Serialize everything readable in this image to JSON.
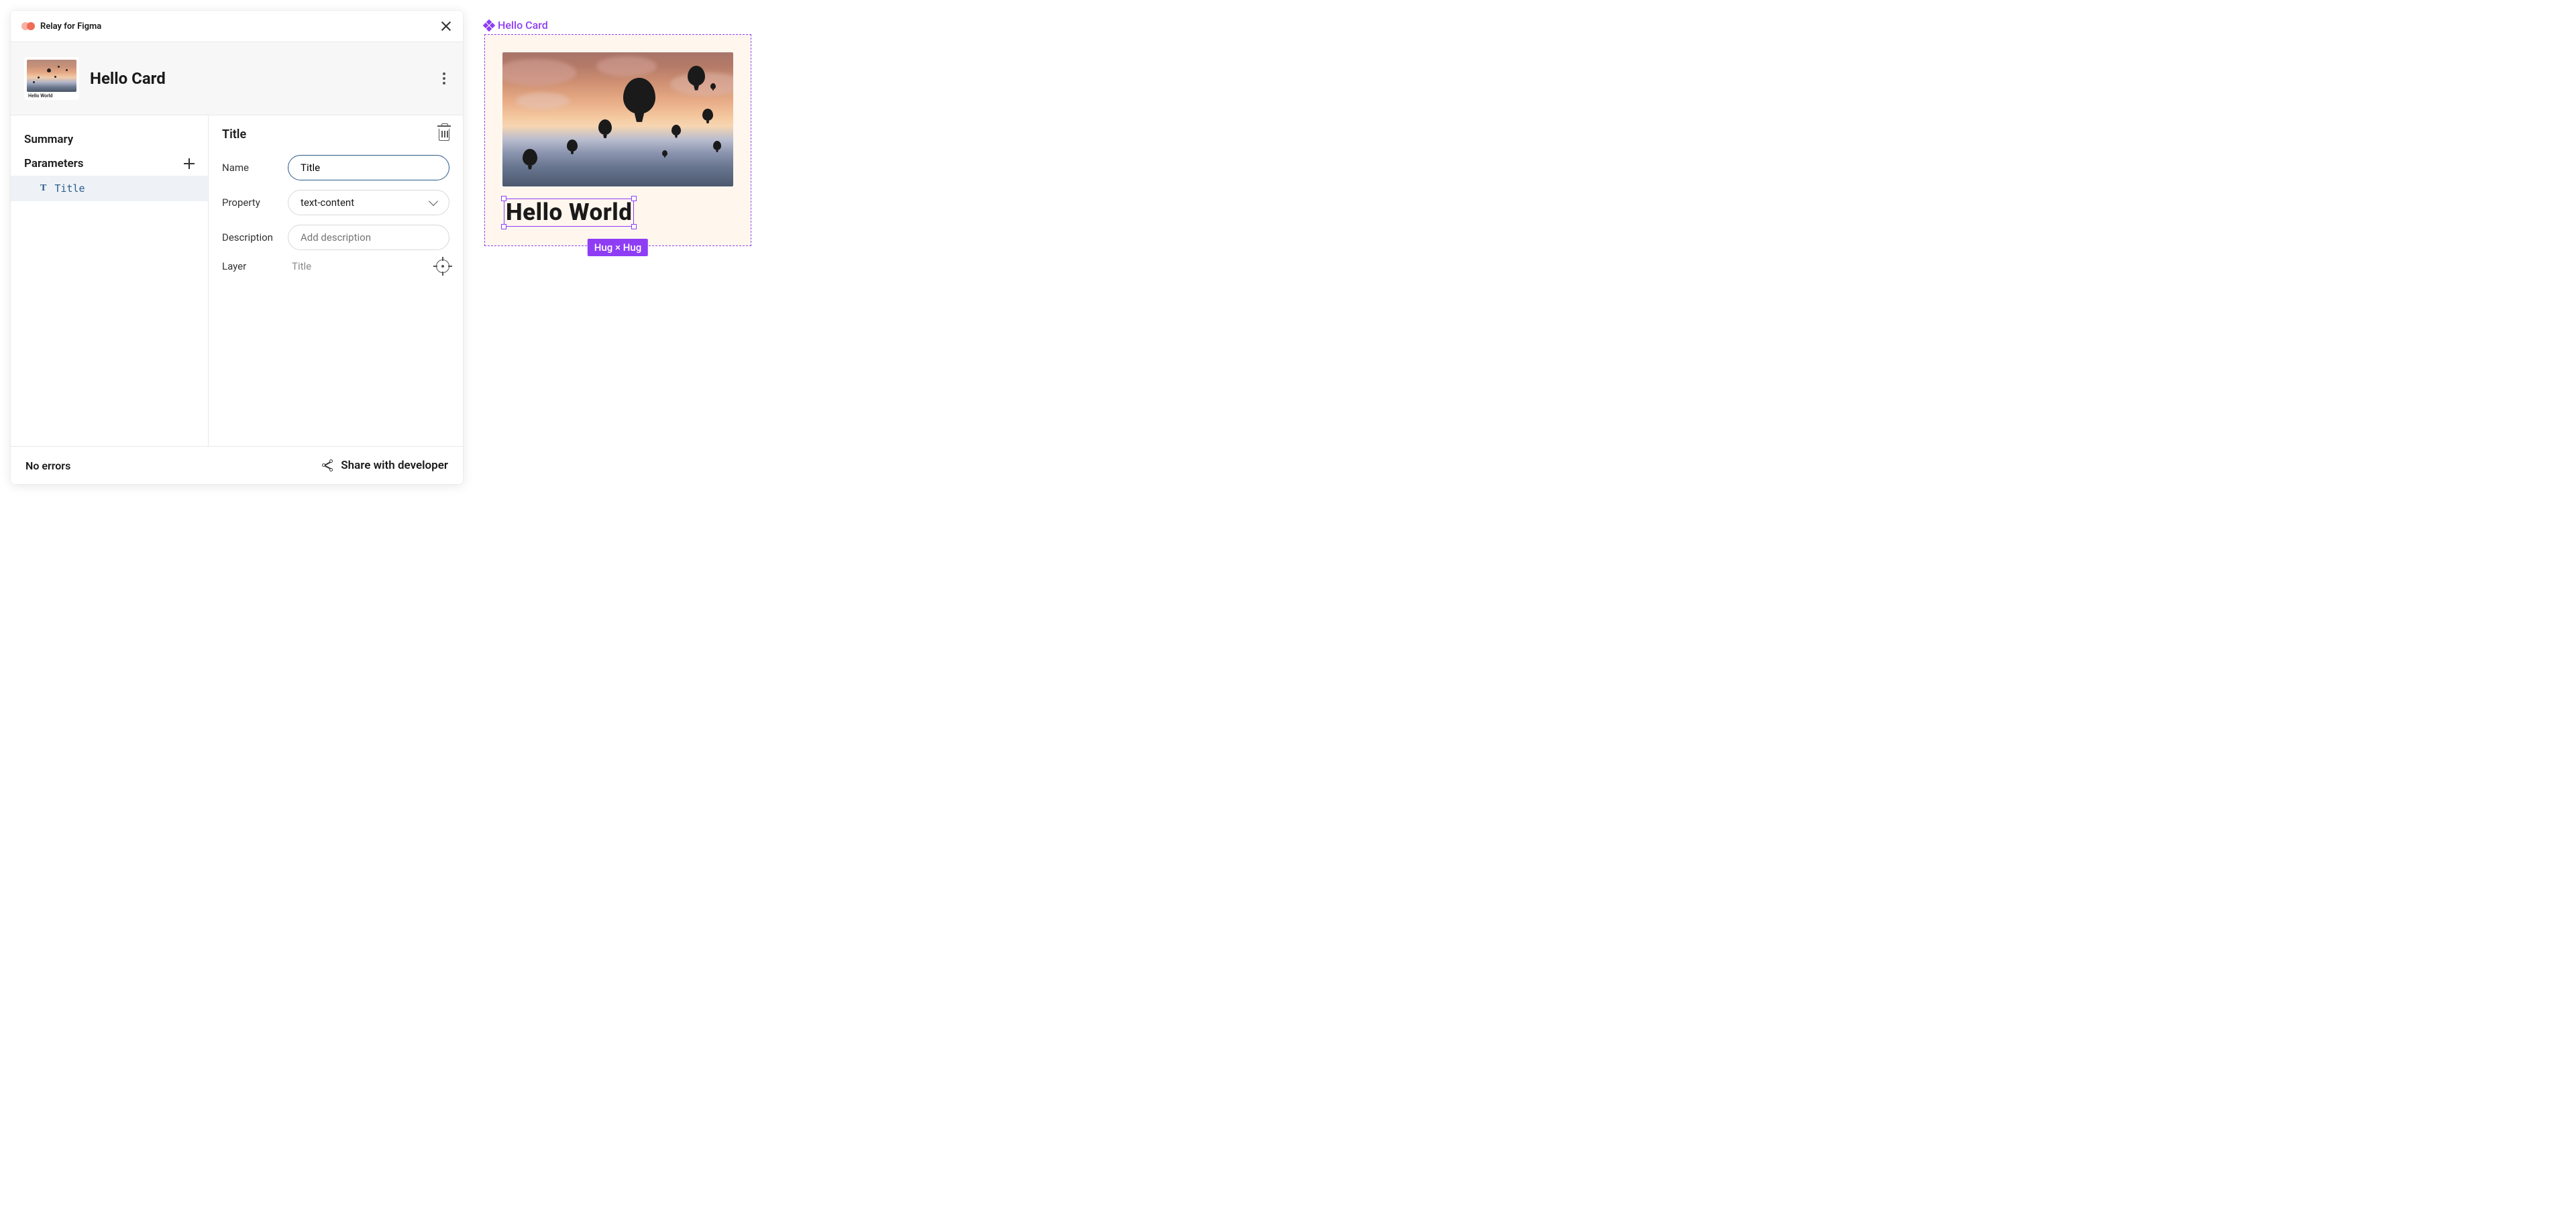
{
  "plugin": {
    "title": "Relay for Figma"
  },
  "component": {
    "name": "Hello Card",
    "thumb_text": "Hello World"
  },
  "sidebar": {
    "summary_label": "Summary",
    "parameters_label": "Parameters",
    "parameters": [
      {
        "type_icon": "T",
        "name": "Title"
      }
    ]
  },
  "detail": {
    "heading": "Title",
    "fields": {
      "name_label": "Name",
      "name_value": "Title",
      "property_label": "Property",
      "property_value": "text-content",
      "description_label": "Description",
      "description_placeholder": "Add description",
      "layer_label": "Layer",
      "layer_value": "Title"
    }
  },
  "footer": {
    "status": "No errors",
    "share_label": "Share with developer"
  },
  "canvas": {
    "component_label": "Hello Card",
    "selected_text": "Hello World",
    "size_badge": "Hug × Hug"
  }
}
